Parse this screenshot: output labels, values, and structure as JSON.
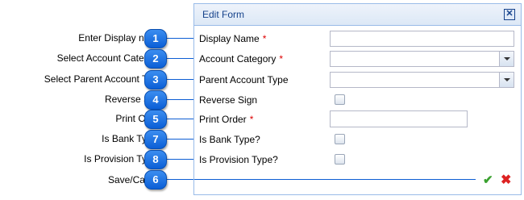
{
  "annotations": [
    {
      "number": "1",
      "label": "Enter Display name"
    },
    {
      "number": "2",
      "label": "Select Account Category"
    },
    {
      "number": "3",
      "label": "Select Parent Account Type"
    },
    {
      "number": "4",
      "label": "Reverse Sign"
    },
    {
      "number": "5",
      "label": "Print Order"
    },
    {
      "number": "7",
      "label": "Is Bank Type?"
    },
    {
      "number": "8",
      "label": "Is Provision Type?"
    },
    {
      "number": "6",
      "label": "Save/Cancel"
    }
  ],
  "form": {
    "title": "Edit Form",
    "close_icon": "close-icon",
    "fields": {
      "display_name": {
        "label": "Display Name",
        "required": "*",
        "value": ""
      },
      "account_category": {
        "label": "Account Category",
        "required": "*",
        "value": ""
      },
      "parent_account_type": {
        "label": "Parent Account Type",
        "value": ""
      },
      "reverse_sign": {
        "label": "Reverse Sign",
        "checked": false
      },
      "print_order": {
        "label": "Print Order",
        "required": "*",
        "value": ""
      },
      "is_bank_type": {
        "label": "Is Bank Type?",
        "checked": false
      },
      "is_provision_type": {
        "label": "Is Provision Type?",
        "checked": false
      }
    },
    "save_icon": "checkmark-icon",
    "cancel_icon": "cross-icon"
  },
  "colors": {
    "badge": "#0b5fd6",
    "connector": "#0d5ed4",
    "header_text": "#15428b",
    "required": "#dd0000",
    "save": "#3aa12f",
    "cancel": "#dd2222"
  }
}
